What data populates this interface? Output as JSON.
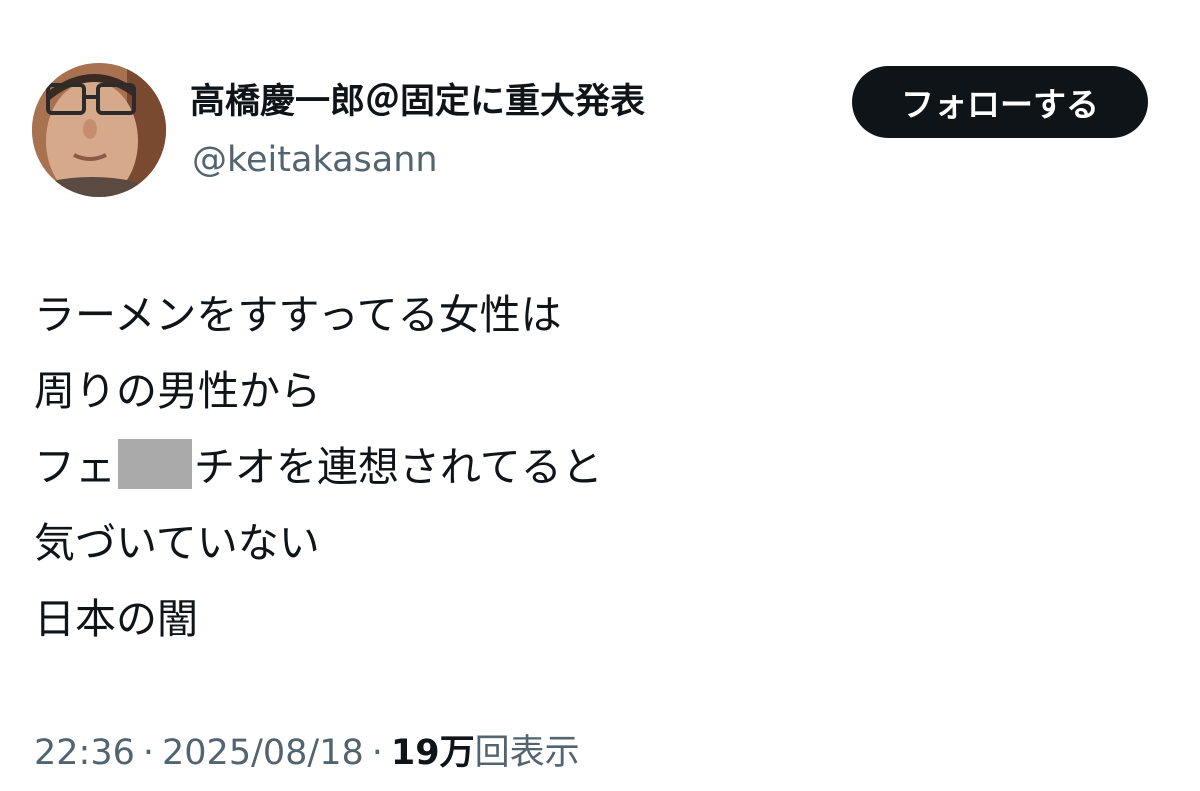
{
  "author": {
    "display_name": "高橋慶一郎＠固定に重大発表",
    "handle": "@keitakasann",
    "avatar_icon": "profile-photo-icon"
  },
  "follow_button": {
    "label": "フォローする"
  },
  "tweet": {
    "lines": [
      "ラーメンをすすってる女性は",
      "周りの男性から",
      {
        "before": "フェ",
        "redacted": true,
        "after": "チオを連想されてると"
      },
      "気づいていない",
      "日本の闇"
    ]
  },
  "meta": {
    "time": "22:36",
    "separator": "·",
    "date": "2025/08/18",
    "views_count": "19万",
    "views_label": "回表示"
  },
  "colors": {
    "text": "#0f1419",
    "secondary": "#536471",
    "button_bg": "#0f1419",
    "redaction": "#aaaaaa"
  }
}
